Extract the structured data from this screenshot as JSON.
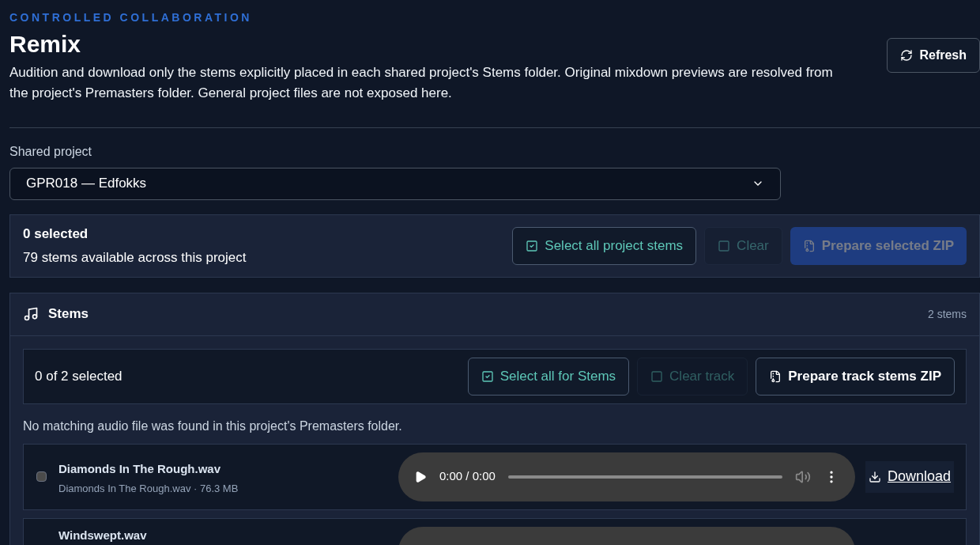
{
  "header": {
    "eyebrow": "CONTROLLED COLLABORATION",
    "title": "Remix",
    "description": "Audition and download only the stems explicitly placed in each shared project's Stems folder. Original mixdown previews are resolved from the project's Premasters folder. General project files are not exposed here.",
    "refresh": "Refresh"
  },
  "project": {
    "label": "Shared project",
    "value": "GPR018 — Edfokks"
  },
  "summary": {
    "count": "0 selected",
    "detail": "79 stems available across this project",
    "buttons": [
      {
        "kind": "select",
        "label": "Select all project stems",
        "disabled": false
      },
      {
        "kind": "clear",
        "label": "Clear",
        "disabled": true
      },
      {
        "kind": "zip",
        "label": "Prepare selected ZIP",
        "disabled": true
      }
    ]
  },
  "track": {
    "title": "Stems",
    "count": "2 stems",
    "selected": "0 of 2 selected",
    "buttons": [
      {
        "kind": "select",
        "label": "Select all for Stems",
        "disabled": false
      },
      {
        "kind": "clear",
        "label": "Clear track",
        "disabled": true
      },
      {
        "kind": "outline",
        "label": "Prepare track stems ZIP",
        "disabled": false
      }
    ],
    "notice": "No matching audio file was found in this project's Premasters folder.",
    "stems": [
      {
        "name": "Diamonds In The Rough.wav",
        "meta": "Diamonds In The Rough.wav · 76.3 MB",
        "checked": false,
        "time": "0:00 / 0:00",
        "download": "Download"
      },
      {
        "name": "Windswept.wav"
      }
    ]
  }
}
